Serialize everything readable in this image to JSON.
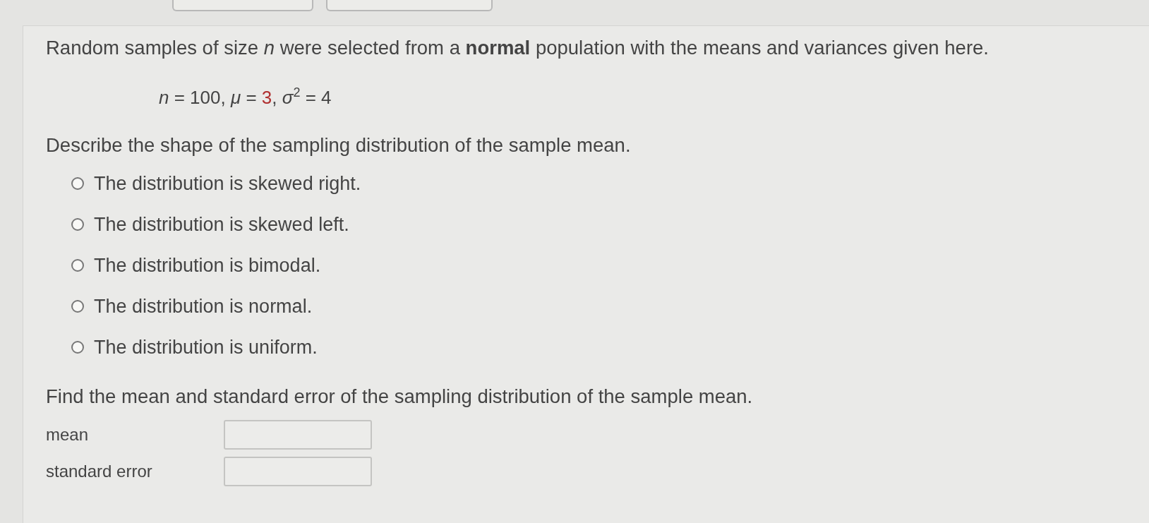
{
  "intro": "Random samples of size *n* were selected from a **normal** population with the means and variances given here.",
  "formula": {
    "before": "*n* = 100, *μ* = ",
    "highlight": "3",
    "after": ", *σ*$^{2}$ = 4"
  },
  "question_1": "Describe the shape of the sampling distribution of the sample mean.",
  "options": [
    {
      "label": "The distribution is skewed right.",
      "selected": false
    },
    {
      "label": "The distribution is skewed left.",
      "selected": false
    },
    {
      "label": "The distribution is bimodal.",
      "selected": false
    },
    {
      "label": "The distribution is normal.",
      "selected": false
    },
    {
      "label": "The distribution is uniform.",
      "selected": false
    }
  ],
  "question_2": "Find the mean and standard error of the sampling distribution of the sample mean.",
  "fields": [
    {
      "label": "mean"
    },
    {
      "label": "standard error"
    }
  ]
}
